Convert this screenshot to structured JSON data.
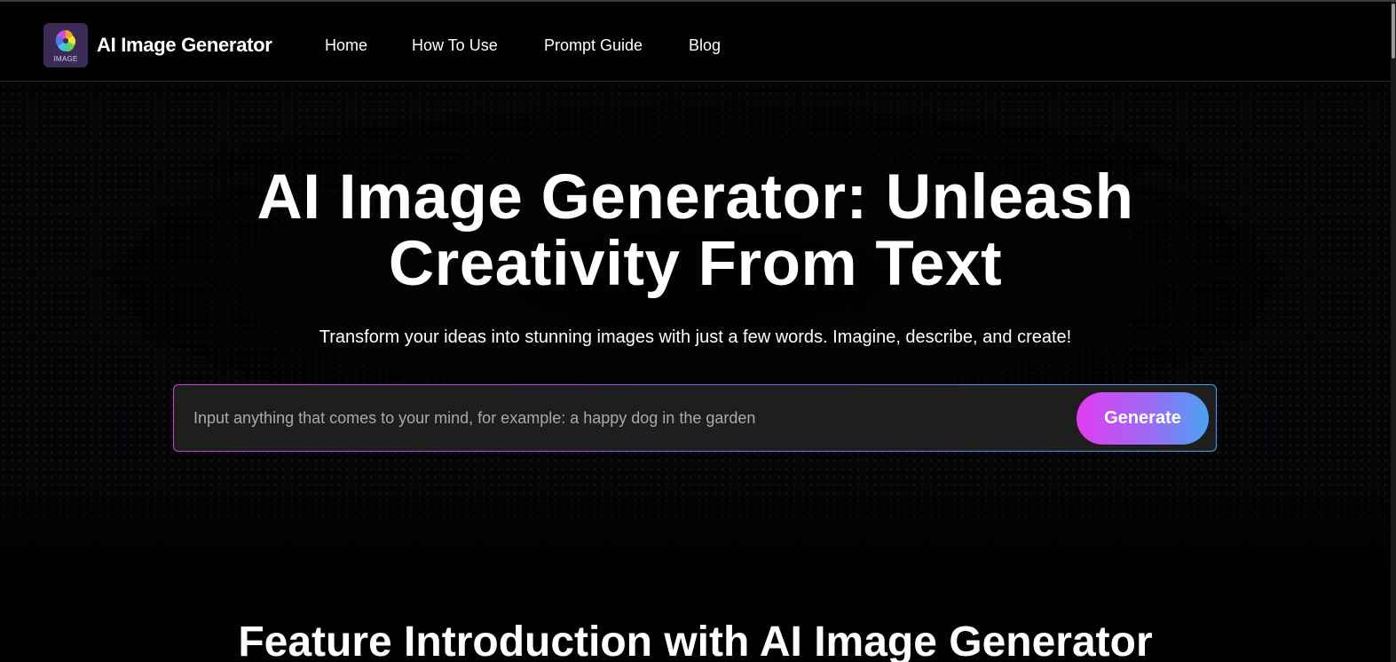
{
  "header": {
    "brand_name": "AI Image Generator",
    "logo_text": "IMAGE",
    "nav": [
      {
        "label": "Home"
      },
      {
        "label": "How To Use"
      },
      {
        "label": "Prompt Guide"
      },
      {
        "label": "Blog"
      }
    ]
  },
  "hero": {
    "title_line1": "AI Image Generator: Unleash",
    "title_line2": "Creativity From Text",
    "subtitle": "Transform your ideas into stunning images with just a few words. Imagine, describe, and create!",
    "prompt": {
      "placeholder": "Input anything that comes to your mind, for example: a happy dog in the garden",
      "value": "",
      "button_label": "Generate"
    }
  },
  "features": {
    "heading": "Feature Introduction with AI Image Generator"
  },
  "colors": {
    "background": "#000000",
    "input_background": "#1e1e1e",
    "accent_pink": "#e23cf0",
    "accent_purple": "#9b6af5",
    "accent_blue": "#4aa2f2",
    "logo_background": "#3b2b56"
  },
  "icons": {
    "logo": "rainbow-spiral-logo-icon"
  }
}
